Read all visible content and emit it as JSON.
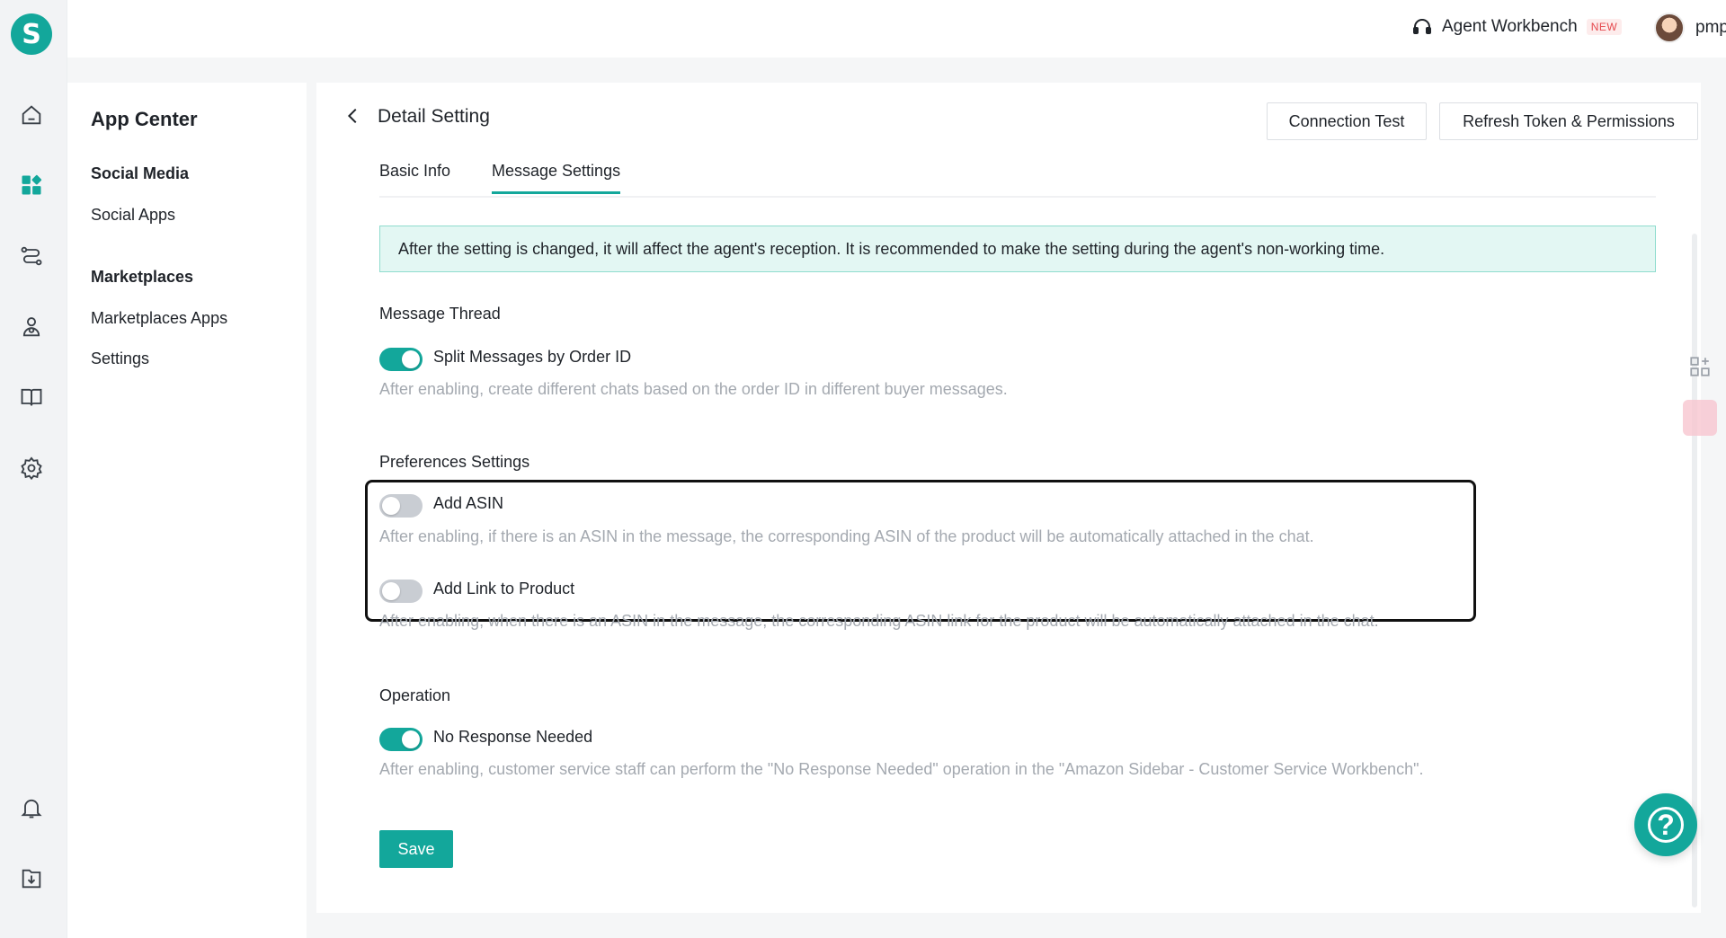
{
  "app": {
    "logo_letter": "S",
    "accent_color": "#13a79b"
  },
  "rail": {
    "icons": [
      "home-icon",
      "apps-icon",
      "routing-icon",
      "contacts-icon",
      "book-icon",
      "gear-icon",
      "bell-icon",
      "download-icon"
    ]
  },
  "topbar": {
    "workbench_label": "Agent Workbench",
    "workbench_badge": "NEW",
    "username": "pmpm"
  },
  "sidebar": {
    "title": "App Center",
    "groups": [
      {
        "label": "Social Media",
        "items": [
          "Social Apps"
        ]
      },
      {
        "label": "Marketplaces",
        "items": [
          "Marketplaces Apps",
          "Settings"
        ]
      }
    ]
  },
  "main": {
    "title": "Detail Setting",
    "buttons": {
      "connection_test": "Connection Test",
      "refresh_token": "Refresh Token & Permissions"
    },
    "tabs": [
      {
        "label": "Basic Info",
        "active": false
      },
      {
        "label": "Message Settings",
        "active": true
      }
    ],
    "notice": "After the setting is changed, it will affect the agent's reception. It is recommended to make the setting during the agent's non-working time.",
    "sections": {
      "message_thread": {
        "title": "Message Thread",
        "split_by_order": {
          "label": "Split Messages by Order ID",
          "enabled": true,
          "desc": "After enabling, create different chats based on the order ID in different buyer messages."
        }
      },
      "preferences": {
        "title": "Preferences Settings",
        "add_asin": {
          "label": "Add ASIN",
          "enabled": false,
          "desc": "After enabling, if there is an ASIN in the message, the corresponding ASIN of the product will be automatically attached in the chat."
        },
        "add_link": {
          "label": "Add Link to Product",
          "enabled": false,
          "desc": "After enabling, when there is an ASIN in the message, the corresponding ASIN link for the product will be automatically attached in the chat."
        }
      },
      "operation": {
        "title": "Operation",
        "no_response": {
          "label": "No Response Needed",
          "enabled": true,
          "desc": "After enabling, customer service staff can perform the \"No Response Needed\" operation in the \"Amazon Sidebar - Customer Service Workbench\"."
        }
      }
    },
    "save_label": "Save",
    "help_glyph": "?"
  }
}
